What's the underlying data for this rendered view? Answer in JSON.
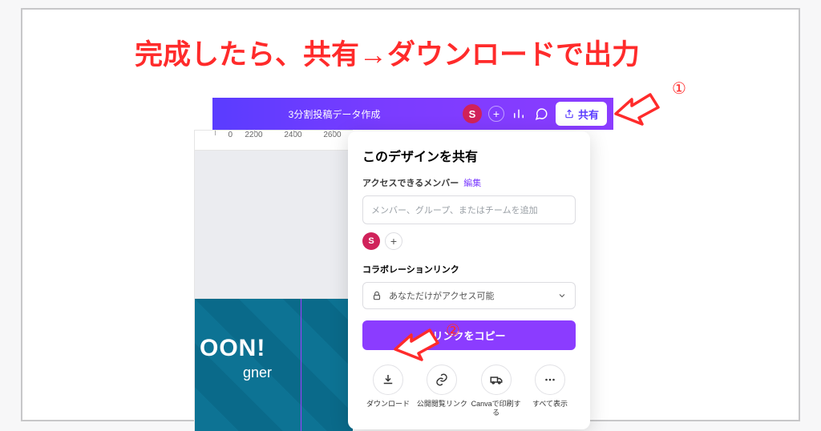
{
  "instruction_headline": "完成したら、共有→ダウンロードで出力",
  "canva_header": {
    "design_title": "3分割投稿データ作成",
    "avatar_letter": "S",
    "share_label": "共有"
  },
  "ruler": {
    "marks": [
      "2200",
      "2400",
      "2600"
    ]
  },
  "share_panel": {
    "title": "このデザインを共有",
    "access_heading": "アクセスできるメンバー",
    "access_edit": "編集",
    "member_placeholder": "メンバー、グループ、またはチームを追加",
    "chip_letter": "S",
    "collab_label": "コラボレーションリンク",
    "access_select_value": "あなただけがアクセス可能",
    "copy_link_label": "リンクをコピー",
    "actions": {
      "download": "ダウンロード",
      "public_link": "公開閲覧リンク",
      "print": "Canvaで印刷する",
      "more": "すべて表示"
    }
  },
  "slide": {
    "big": "OON!",
    "sub": "gner"
  },
  "annotations": {
    "step1": "①",
    "step2": "②"
  }
}
